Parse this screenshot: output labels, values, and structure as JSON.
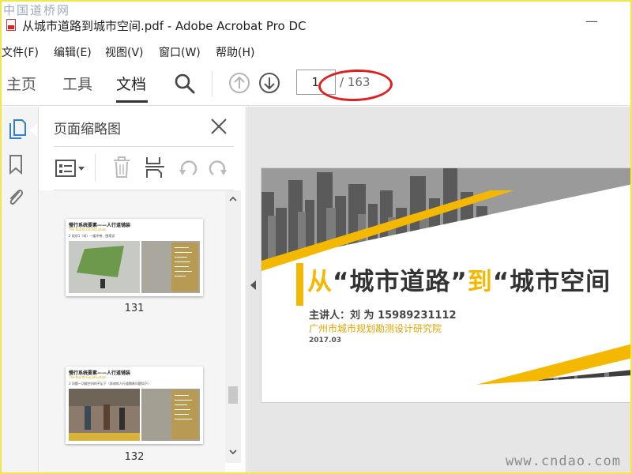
{
  "watermark": {
    "top": "中国道桥网",
    "bottom": "www.cndao.com"
  },
  "window": {
    "title": "从城市道路到城市空间.pdf - Adobe Acrobat Pro DC",
    "minimize": "—"
  },
  "menu": [
    "文件(F)",
    "编辑(E)",
    "视图(V)",
    "窗口(W)",
    "帮助(H)"
  ],
  "toolbar": {
    "tabs": [
      "主页",
      "工具",
      "文档"
    ],
    "active_tab": "文档",
    "page_current": "1",
    "page_total": "/ 163"
  },
  "sidebar": {
    "icons": [
      "page-thumbnails-icon",
      "bookmark-icon",
      "attachment-icon"
    ],
    "active": "page-thumbnails-icon"
  },
  "thumbnail_panel": {
    "title": "页面缩略图",
    "tools": [
      "options-menu-icon",
      "delete-icon",
      "rotate-page-icon",
      "undo-icon",
      "redo-icon"
    ],
    "thumbnails": [
      {
        "page": "131",
        "title": "慢行系统要素——人行道铺装",
        "subtitle": "The fourth  Construction",
        "line": "2 现状1（续）—缓冲带、围墙设"
      },
      {
        "page": "132",
        "title": "慢行系统要素——人行道铺装",
        "subtitle": "The fourth  Construction",
        "line": "3 问题—功能空间的不足下（质询的人行道铺装问题如下）"
      }
    ]
  },
  "slide": {
    "title_part1": "从",
    "title_part2": "“城市道路”",
    "title_part3": "到",
    "title_part4": "“城市空间",
    "presenter": "主讲人：刘 为    15989231112",
    "institute": "广州市城市规划勘测设计研究院",
    "date": "2017.03"
  },
  "colors": {
    "accent_yellow": "#f5b800",
    "annotation_red": "#e02020",
    "frame_yellow": "#f2e64a"
  }
}
